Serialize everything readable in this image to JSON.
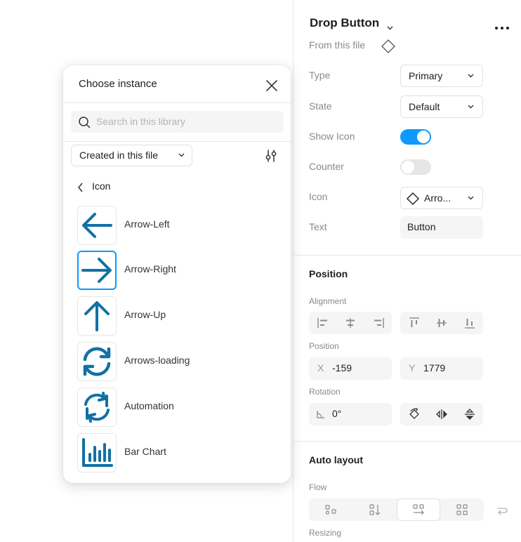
{
  "colors": {
    "accent": "#0d99ff",
    "icon_blue": "#1171a5",
    "toggle_off": "#e6e6e6"
  },
  "instance_picker": {
    "title": "Choose instance",
    "search_placeholder": "Search in this library",
    "filter_label": "Created in this file",
    "breadcrumb": "Icon",
    "items": [
      {
        "label": "Arrow-Left",
        "icon": "arrow-left-icon",
        "selected": false
      },
      {
        "label": "Arrow-Right",
        "icon": "arrow-right-icon",
        "selected": true
      },
      {
        "label": "Arrow-Up",
        "icon": "arrow-up-icon",
        "selected": false
      },
      {
        "label": "Arrows-loading",
        "icon": "arrows-loading-icon",
        "selected": false
      },
      {
        "label": "Automation",
        "icon": "automation-icon",
        "selected": false
      },
      {
        "label": "Bar Chart",
        "icon": "bar-chart-icon",
        "selected": false
      }
    ]
  },
  "properties": {
    "component_name": "Drop Button",
    "source": "From this file",
    "type_label": "Type",
    "type_value": "Primary",
    "state_label": "State",
    "state_value": "Default",
    "show_icon_label": "Show Icon",
    "show_icon_on": true,
    "counter_label": "Counter",
    "counter_on": false,
    "icon_label": "Icon",
    "icon_value": "Arro...",
    "text_label": "Text",
    "text_value": "Button"
  },
  "position": {
    "title": "Position",
    "alignment_label": "Alignment",
    "position_label": "Position",
    "x_prefix": "X",
    "x_value": "-159",
    "y_prefix": "Y",
    "y_value": "1779",
    "rotation_label": "Rotation",
    "rotation_value": "0°"
  },
  "auto_layout": {
    "title": "Auto layout",
    "flow_label": "Flow",
    "flow_selected": "horizontal",
    "resizing_label": "Resizing"
  }
}
